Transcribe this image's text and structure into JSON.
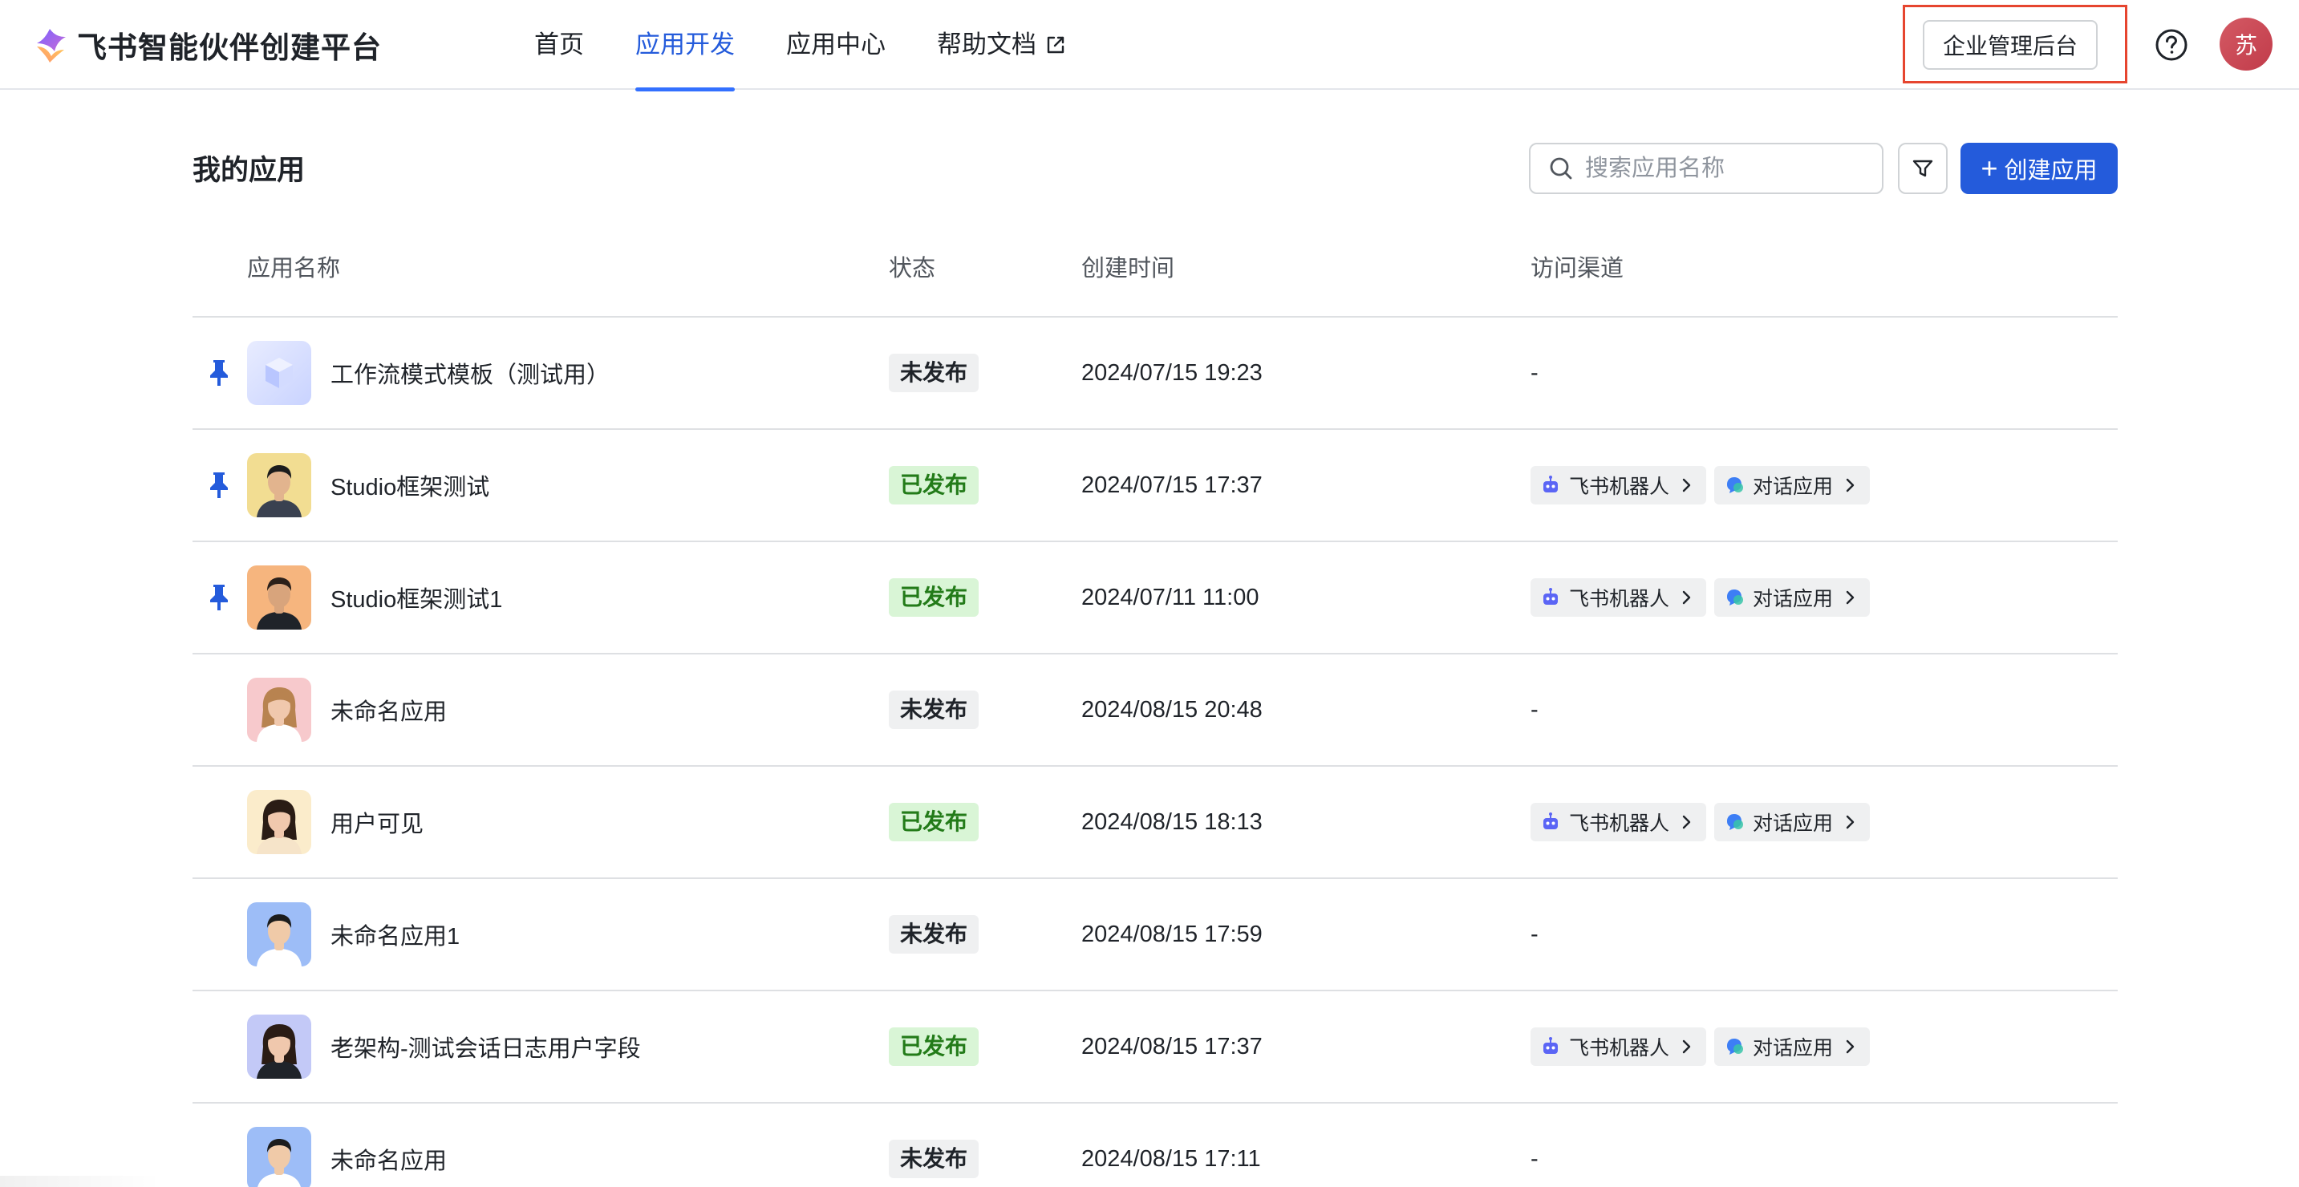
{
  "brand": {
    "name": "飞书智能伙伴创建平台",
    "logo": "feishu-aily-logo"
  },
  "nav": {
    "items": [
      {
        "label": "首页",
        "active": false
      },
      {
        "label": "应用开发",
        "active": true
      },
      {
        "label": "应用中心",
        "active": false
      },
      {
        "label": "帮助文档",
        "active": false,
        "icon": "external-link-icon"
      }
    ]
  },
  "header": {
    "admin_label": "企业管理后台",
    "help_icon": "question-circle-icon",
    "user_initial": "苏",
    "accent": "#245bdb",
    "highlight_color": "#e6452f"
  },
  "page": {
    "title": "我的应用",
    "search_placeholder": "搜索应用名称",
    "filter_icon": "filter-icon",
    "create_label": "创建应用"
  },
  "table": {
    "columns": [
      "应用名称",
      "状态",
      "创建时间",
      "访问渠道"
    ],
    "rows": [
      {
        "pinned": true,
        "avatar": "cube",
        "name": "工作流模式模板（测试用）",
        "status": "未发布",
        "published": false,
        "created": "2024/07/15 19:23",
        "channels_text": "-",
        "channels": []
      },
      {
        "pinned": true,
        "avatar": "man-suit-yellow",
        "name": "Studio框架测试",
        "status": "已发布",
        "published": true,
        "created": "2024/07/15 17:37",
        "channels_text": "",
        "channels": [
          "飞书机器人",
          "对话应用"
        ]
      },
      {
        "pinned": true,
        "avatar": "man-beard-orange",
        "name": "Studio框架测试1",
        "status": "已发布",
        "published": true,
        "created": "2024/07/11 11:00",
        "channels_text": "",
        "channels": [
          "飞书机器人",
          "对话应用"
        ]
      },
      {
        "pinned": false,
        "avatar": "woman-pink",
        "name": "未命名应用",
        "status": "未发布",
        "published": false,
        "created": "2024/08/15 20:48",
        "channels_text": "-",
        "channels": []
      },
      {
        "pinned": false,
        "avatar": "woman-cream",
        "name": "用户可见",
        "status": "已发布",
        "published": true,
        "created": "2024/08/15 18:13",
        "channels_text": "",
        "channels": [
          "飞书机器人",
          "对话应用"
        ]
      },
      {
        "pinned": false,
        "avatar": "man-blue",
        "name": "未命名应用1",
        "status": "未发布",
        "published": false,
        "created": "2024/08/15 17:59",
        "channels_text": "-",
        "channels": []
      },
      {
        "pinned": false,
        "avatar": "woman-lavender",
        "name": "老架构-测试会话日志用户字段",
        "status": "已发布",
        "published": true,
        "created": "2024/08/15 17:37",
        "channels_text": "",
        "channels": [
          "飞书机器人",
          "对话应用"
        ]
      },
      {
        "pinned": false,
        "avatar": "man-blue",
        "name": "未命名应用",
        "status": "未发布",
        "published": false,
        "created": "2024/08/15 17:11",
        "channels_text": "-",
        "channels": []
      }
    ],
    "channel_icons": {
      "飞书机器人": "robot-icon",
      "对话应用": "chat-bubble-icon"
    }
  }
}
